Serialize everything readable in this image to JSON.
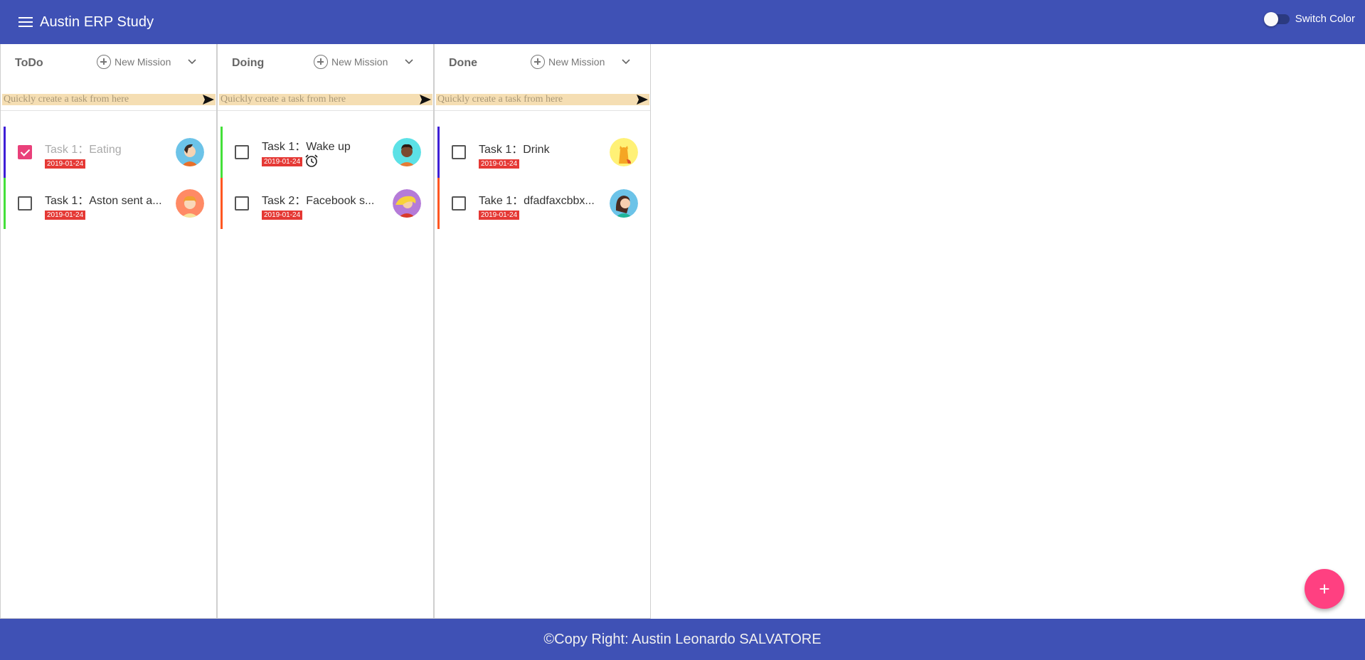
{
  "header": {
    "title": "Austin ERP Study",
    "switch_label": "Switch Color"
  },
  "quick_placeholder": "Quickly create a task from here",
  "new_mission_label": "New Mission",
  "columns": [
    {
      "title": "ToDo",
      "tasks": [
        {
          "title": "Task 1：Eating",
          "date": "2019-01-24",
          "done": true,
          "bar_color": "#3f1fd6"
        },
        {
          "title": "Task 1：Aston sent a...",
          "date": "2019-01-24",
          "done": false,
          "bar_color": "#44e03a"
        }
      ]
    },
    {
      "title": "Doing",
      "tasks": [
        {
          "title": "Task 1：Wake up",
          "date": "2019-01-24",
          "done": false,
          "bar_color": "#44e03a",
          "alarm": true
        },
        {
          "title": "Task 2：Facebook s...",
          "date": "2019-01-24",
          "done": false,
          "bar_color": "#ff5722"
        }
      ]
    },
    {
      "title": "Done",
      "tasks": [
        {
          "title": "Task 1：Drink",
          "date": "2019-01-24",
          "done": false,
          "bar_color": "#3f1fd6"
        },
        {
          "title": "Take 1：dfadfaxcbbx...",
          "date": "2019-01-24",
          "done": false,
          "bar_color": "#ff5722"
        }
      ]
    }
  ],
  "footer": {
    "text": "©Copy Right: Austin Leonardo SALVATORE"
  },
  "fab": {
    "label": "+"
  },
  "colors": {
    "primary": "#3f51b5",
    "accent": "#ff4081",
    "quick_bg": "#f5deb3",
    "date_badge": "#e53935"
  }
}
